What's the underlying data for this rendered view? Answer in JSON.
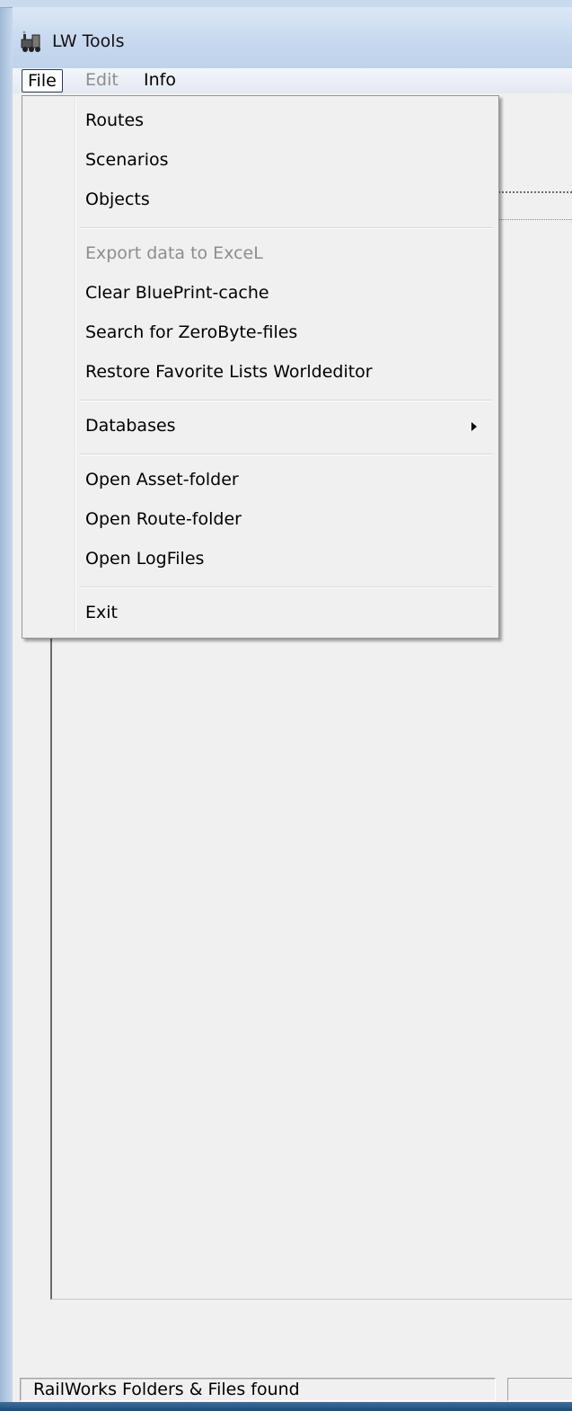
{
  "window": {
    "title": "LW Tools",
    "icon": "steam-locomotive-icon"
  },
  "menubar": {
    "items": [
      {
        "label": "File",
        "state": "open"
      },
      {
        "label": "Edit",
        "state": "disabled"
      },
      {
        "label": "Info",
        "state": "enabled"
      }
    ]
  },
  "file_menu": {
    "items": [
      {
        "label": "Routes",
        "enabled": true
      },
      {
        "label": "Scenarios",
        "enabled": true
      },
      {
        "label": "Objects",
        "enabled": true
      },
      {
        "label": "Export data to ExceL",
        "enabled": false
      },
      {
        "label": "Clear BluePrint-cache",
        "enabled": true
      },
      {
        "label": "Search for ZeroByte-files",
        "enabled": true
      },
      {
        "label": "Restore Favorite Lists Worldeditor",
        "enabled": true
      },
      {
        "label": "Databases",
        "enabled": true,
        "submenu": true,
        "submenu_icon": "chevron-right-icon"
      },
      {
        "label": "Open Asset-folder",
        "enabled": true
      },
      {
        "label": "Open Route-folder",
        "enabled": true
      },
      {
        "label": "Open LogFiles",
        "enabled": true
      },
      {
        "label": "Exit",
        "enabled": true
      }
    ]
  },
  "statusbar": {
    "text": "RailWorks Folders & Files found",
    "secondary": ""
  },
  "colors": {
    "disabled_text": "#8d8d8d",
    "menu_background": "#f0f0f0",
    "title_bar": "#c5d7ee",
    "taskbar": "#1d4b78"
  }
}
